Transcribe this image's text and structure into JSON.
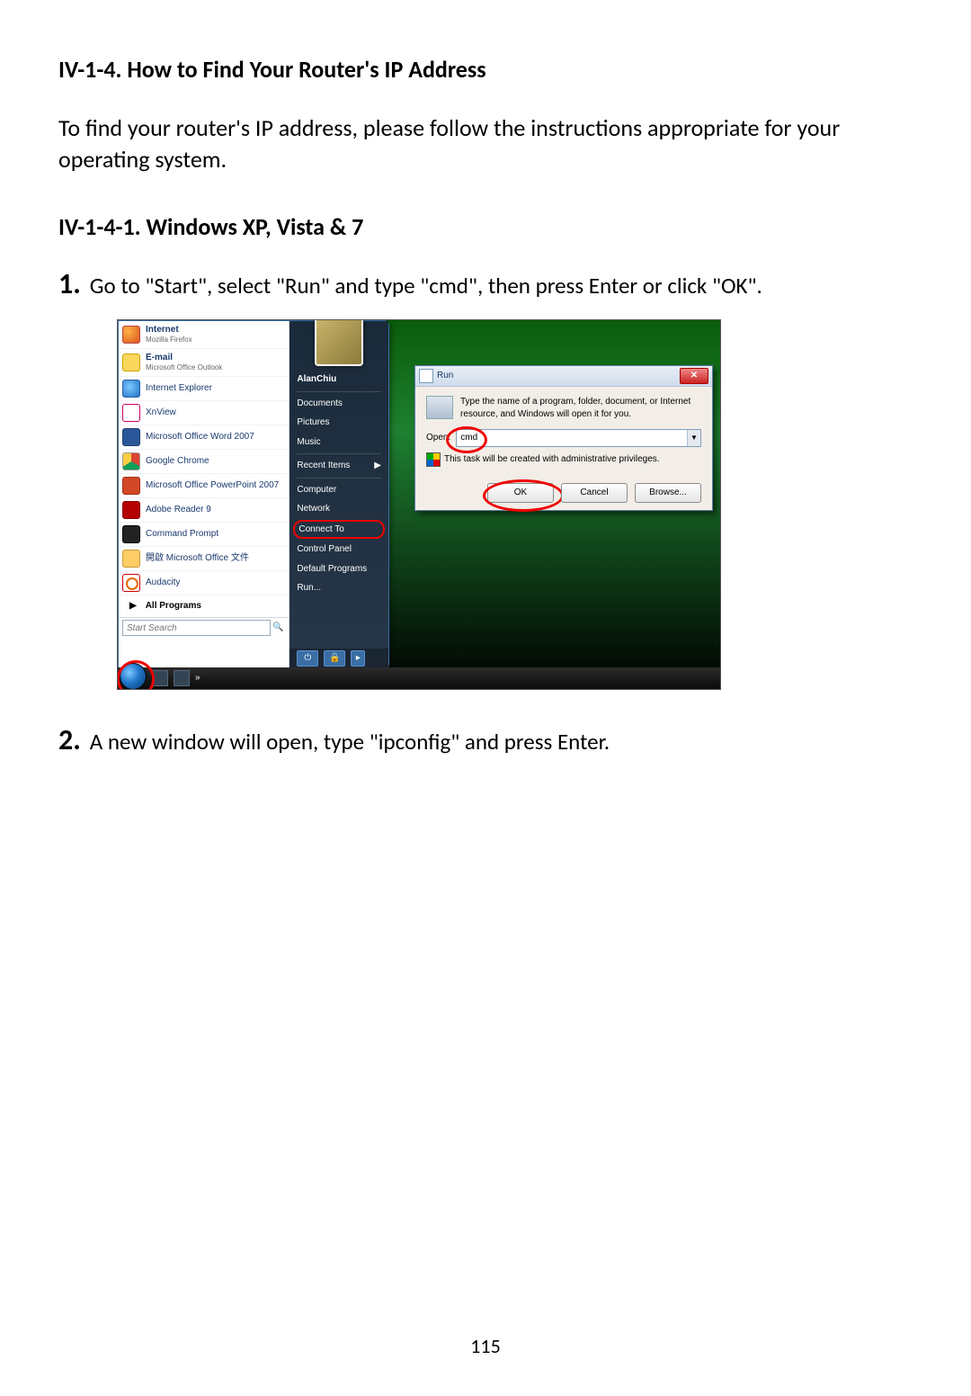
{
  "heading_section": "IV-1-4. How to Find Your Router's IP Address",
  "intro": "To find your router's IP address, please follow the instructions appropriate for your operating system.",
  "heading_sub": "IV-1-4-1.   Windows XP, Vista & 7",
  "step1_num": "1.",
  "step1_text": "Go to \"Start\", select \"Run\" and type \"cmd\", then press Enter or click \"OK\".",
  "step2_num": "2.",
  "step2_text": "A new window will open, type \"ipconfig\" and press Enter.",
  "page_number": "115",
  "startmenu": {
    "internet": {
      "title": "Internet",
      "sub": "Mozilla Firefox"
    },
    "email": {
      "title": "E-mail",
      "sub": "Microsoft Office Outlook"
    },
    "items": [
      "Internet Explorer",
      "XnView",
      "Microsoft Office Word 2007",
      "Google Chrome",
      "Microsoft Office PowerPoint 2007",
      "Adobe Reader 9",
      "Command Prompt",
      "開啟 Microsoft Office 文件",
      "Audacity"
    ],
    "all_programs": "All Programs",
    "search_placeholder": "Start Search"
  },
  "rightcol": {
    "user": "AlanChiu",
    "links": [
      "Documents",
      "Pictures",
      "Music"
    ],
    "recent": "Recent Items",
    "links2": [
      "Computer",
      "Network"
    ],
    "connect_to": "Connect To",
    "links3": [
      "Control Panel",
      "Default Programs",
      "Run..."
    ]
  },
  "run": {
    "title": "Run",
    "desc": "Type the name of a program, folder, document, or Internet resource, and Windows will open it for you.",
    "open_label": "Open:",
    "open_value": "cmd",
    "priv": "This task will be created with administrative privileges.",
    "ok": "OK",
    "cancel": "Cancel",
    "browse": "Browse..."
  }
}
